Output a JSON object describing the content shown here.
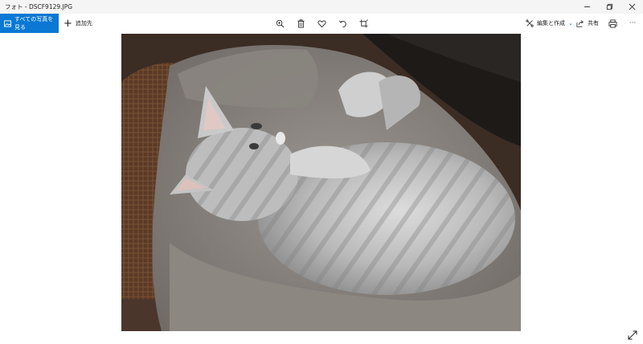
{
  "window": {
    "title": "フォト - DSCF9129.JPG"
  },
  "toolbar": {
    "all_photos_label": "すべての写真を見る",
    "add_to_label": "追加先",
    "edit_create_label": "編集と作成",
    "share_label": "共有",
    "more_label": "···"
  },
  "icons": {
    "zoom": "zoom-in-icon",
    "delete": "trash-icon",
    "favorite": "heart-icon",
    "rotate": "rotate-icon",
    "crop": "crop-icon",
    "print": "printer-icon",
    "fullscreen": "expand-icon"
  },
  "colors": {
    "accent": "#0a78d4"
  },
  "viewer": {
    "photo_description_name": "cat-photo"
  }
}
